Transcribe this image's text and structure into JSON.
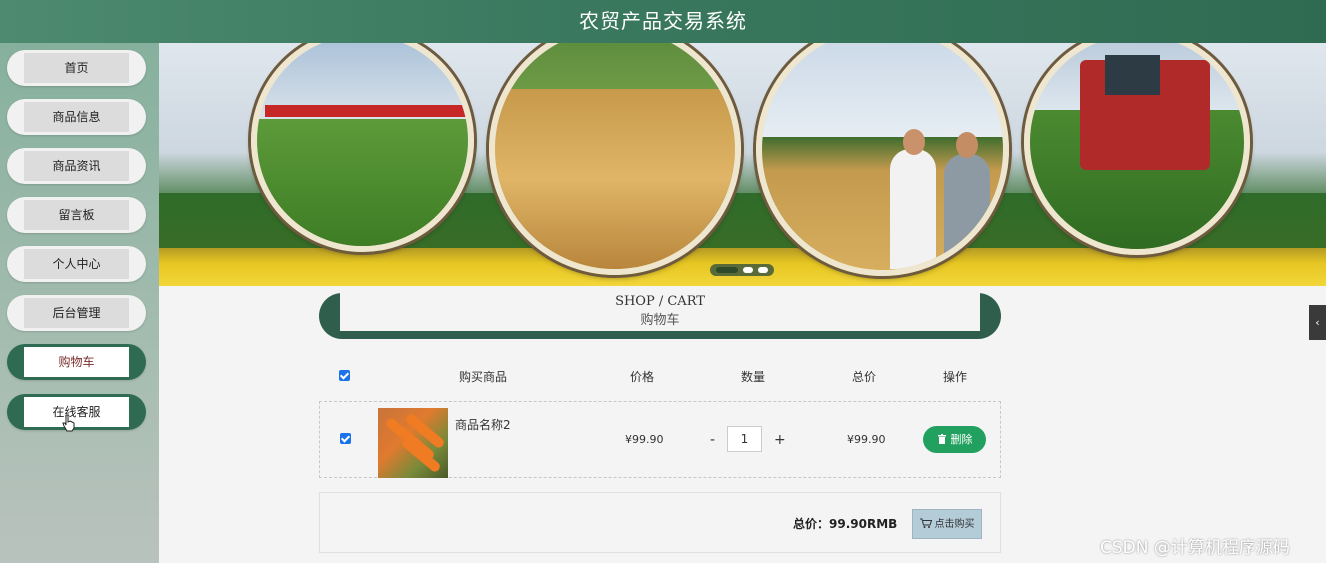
{
  "header": {
    "title": "农贸产品交易系统"
  },
  "sidebar": {
    "items": [
      {
        "label": "首页",
        "state": "default"
      },
      {
        "label": "商品信息",
        "state": "default"
      },
      {
        "label": "商品资讯",
        "state": "default"
      },
      {
        "label": "留言板",
        "state": "default"
      },
      {
        "label": "个人中心",
        "state": "default"
      },
      {
        "label": "后台管理",
        "state": "default"
      },
      {
        "label": "购物车",
        "state": "active"
      },
      {
        "label": "在线客服",
        "state": "hover"
      }
    ]
  },
  "banner": {
    "slides": 3,
    "active_slide": 1
  },
  "cart": {
    "title_en": "SHOP / CART",
    "title_zh": "购物车",
    "columns": [
      "购买商品",
      "价格",
      "数量",
      "总价",
      "操作"
    ],
    "items": [
      {
        "checked": true,
        "name": "商品名称2",
        "price": "¥99.90",
        "quantity": "1",
        "total": "¥99.90",
        "delete_label": "删除"
      }
    ],
    "minus": "-",
    "plus": "+",
    "total_label": "总价：99.90RMB",
    "buy_label": "点击购买"
  },
  "side_toggle": "‹",
  "watermark": "CSDN @计算机程序源码",
  "colors": {
    "header_green": "#3b7a60",
    "active_green": "#2f6b52",
    "delete_green": "#22a060",
    "buy_blue": "#b4ccd8"
  }
}
